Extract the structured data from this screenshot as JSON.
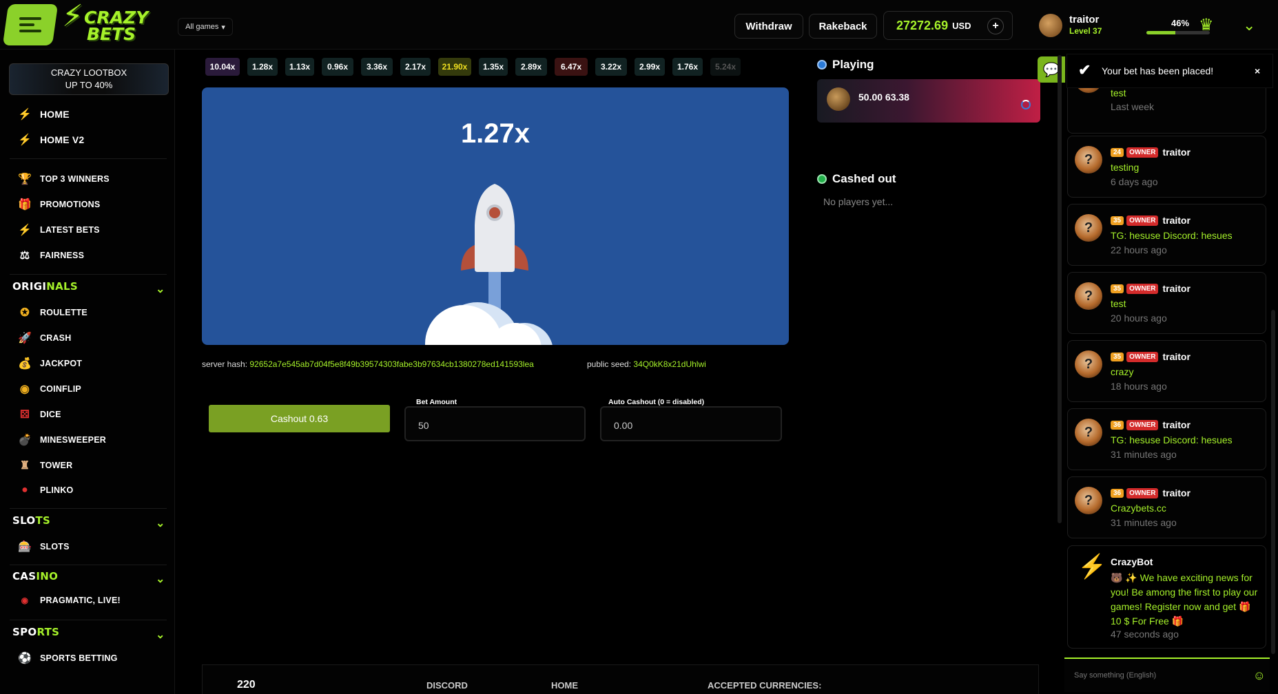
{
  "header": {
    "brand_line1": "CRAZY",
    "brand_line2": "BETS",
    "all_games": "All games",
    "withdraw": "Withdraw",
    "rakeback": "Rakeback",
    "balance": "27272.69",
    "currency": "USD",
    "plus": "+",
    "user_name": "traitor",
    "user_level": "Level 37",
    "xp_percent_label": "46%",
    "xp_fraction": 0.46
  },
  "sidebar": {
    "lootbox_line1": "CRAZY LOOTBOX",
    "lootbox_line2": "UP TO 40%",
    "home": "HOME",
    "home_v2": "HOME V2",
    "top_winners": "TOP 3 WINNERS",
    "promotions": "PROMOTIONS",
    "latest_bets": "LATEST BETS",
    "fairness": "FAIRNESS",
    "originals_a": "ORIGI",
    "originals_b": "NALS",
    "roulette": "ROULETTE",
    "crash": "CRASH",
    "jackpot": "JACKPOT",
    "coinflip": "COINFLIP",
    "dice": "DICE",
    "minesweeper": "MINESWEEPER",
    "tower": "TOWER",
    "plinko": "PLINKO",
    "slots_a": "SLO",
    "slots_b": "TS",
    "slots_item": "SLOTS",
    "casino_a": "CAS",
    "casino_b": "INO",
    "pragmatic": "PRAGMATIC, LIVE!",
    "sports_a": "SPO",
    "sports_b": "RTS",
    "sports_betting": "SPORTS BETTING"
  },
  "history": [
    {
      "v": "10.04x",
      "c": "#2a1a3a",
      "t": "#fff"
    },
    {
      "v": "1.28x",
      "c": "#112222",
      "t": "#fff"
    },
    {
      "v": "1.13x",
      "c": "#112222",
      "t": "#fff"
    },
    {
      "v": "0.96x",
      "c": "#112222",
      "t": "#fff"
    },
    {
      "v": "3.36x",
      "c": "#112222",
      "t": "#fff"
    },
    {
      "v": "2.17x",
      "c": "#112222",
      "t": "#fff"
    },
    {
      "v": "21.90x",
      "c": "#343a0c",
      "t": "#f0e020"
    },
    {
      "v": "1.35x",
      "c": "#112222",
      "t": "#fff"
    },
    {
      "v": "2.89x",
      "c": "#112222",
      "t": "#fff"
    },
    {
      "v": "6.47x",
      "c": "#3a1212",
      "t": "#fff"
    },
    {
      "v": "3.22x",
      "c": "#112222",
      "t": "#fff"
    },
    {
      "v": "2.99x",
      "c": "#112222",
      "t": "#fff"
    },
    {
      "v": "1.76x",
      "c": "#112222",
      "t": "#fff"
    },
    {
      "v": "5.24x",
      "c": "#0c1212",
      "t": "#555"
    }
  ],
  "game": {
    "multiplier": "1.27x",
    "server_hash_label": "server hash:",
    "server_hash": "92652a7e545ab7d04f5e8f49b39574303fabe3b97634cb1380278ed141593lea",
    "public_seed_label": "public seed:",
    "public_seed": "34Q0kK8x21dUhlwi",
    "cashout_label": "Cashout 0.63",
    "bet_amount_label": "Bet Amount",
    "bet_amount": "50",
    "auto_cashout_label": "Auto Cashout (0 = disabled)",
    "auto_cashout": "0.00"
  },
  "players": {
    "playing_title": "Playing",
    "playing_entry": "50.00 63.38",
    "cashed_out_title": "Cashed out",
    "no_players": "No players yet..."
  },
  "toast": {
    "text": "Your bet has been placed!",
    "close": "×"
  },
  "chat": {
    "messages": [
      {
        "level": "",
        "role": "",
        "name": "",
        "text": "test",
        "time": "Last week"
      },
      {
        "level": "24",
        "role": "OWNER",
        "name": "traitor",
        "text": "testing",
        "time": "6 days ago"
      },
      {
        "level": "35",
        "role": "OWNER",
        "name": "traitor",
        "text": "TG: hesuse Discord: hesues",
        "time": "22 hours ago"
      },
      {
        "level": "35",
        "role": "OWNER",
        "name": "traitor",
        "text": "test",
        "time": "20 hours ago"
      },
      {
        "level": "35",
        "role": "OWNER",
        "name": "traitor",
        "text": "crazy",
        "time": "18 hours ago"
      },
      {
        "level": "36",
        "role": "OWNER",
        "name": "traitor",
        "text": "TG: hesuse Discord: hesues",
        "time": "31 minutes ago"
      },
      {
        "level": "36",
        "role": "OWNER",
        "name": "traitor",
        "text": "Crazybets.cc",
        "time": "31 minutes ago"
      }
    ],
    "bot_name": "CrazyBot",
    "bot_text": "🐻 ✨ We have exciting news for you! Be among the first to play our games! Register now and get 🎁 10 $ For Free 🎁",
    "bot_time": "47 seconds ago",
    "input_placeholder": "Say something (English)"
  },
  "footer": {
    "count": "220",
    "discord": "DISCORD",
    "home": "HOME",
    "currencies": "ACCEPTED CURRENCIES:"
  },
  "icons": {
    "menu": "hamburger-icon",
    "bolt": "lightning-icon",
    "trophy": "trophy-icon",
    "gift": "gift-icon",
    "crown": "crown-icon",
    "chat": "chat-icon",
    "check": "check-icon"
  },
  "colors": {
    "accent": "#a6f22a",
    "game_bg": "#25539a",
    "cashout": "#7aa023",
    "owner_badge": "#d42b2b",
    "level_badge": "#f0a020"
  }
}
